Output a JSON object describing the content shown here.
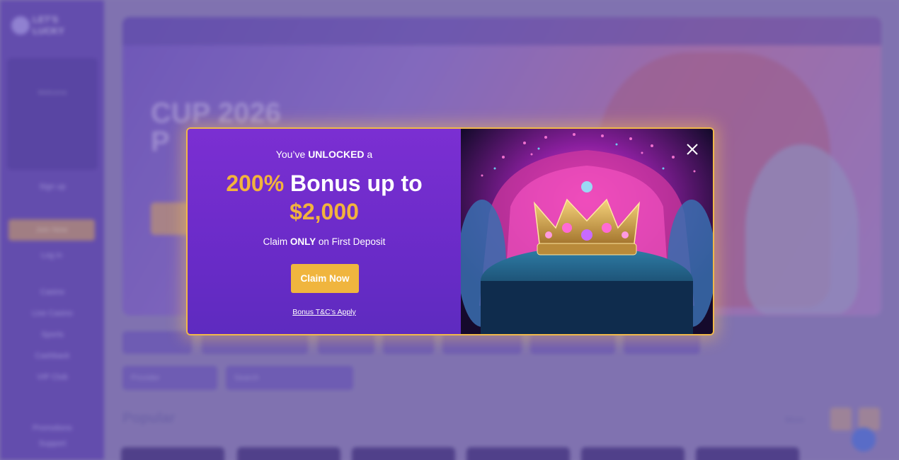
{
  "background": {
    "logo_text": "LET'S LUCKY",
    "sidebar": {
      "welcome_text": "Welcome",
      "login_prompt": "Sign up",
      "join_label": "Join Now",
      "login_label": "Log in",
      "nav_items": [
        "Casino",
        "Live Casino",
        "Sports",
        "Cashback",
        "VIP Club"
      ],
      "bottom_items": [
        "Promotions",
        "Support"
      ]
    },
    "hero": {
      "title_line1": "CUP 2026",
      "title_line2": "P"
    },
    "filters": [
      "Provider",
      "Search"
    ],
    "section_title": "Popular",
    "more_label": "More"
  },
  "modal": {
    "unlock_prefix": "You’ve ",
    "unlock_bold": "UNLOCKED",
    "unlock_suffix": " a",
    "headline_pct": "200%",
    "headline_rest": " Bonus up to",
    "headline_amount": "$2,000",
    "claim_prefix": "Claim ",
    "claim_bold": "ONLY",
    "claim_suffix": " on First Deposit",
    "cta_label": "Claim Now",
    "terms_label": "Bonus T&C’s Apply",
    "close_icon": "close-icon",
    "image_subject": "crown-on-throne-image"
  },
  "colors": {
    "accent_gold": "#f2b33d",
    "modal_purple": "#7b2fd2",
    "modal_border": "#f0b84a"
  }
}
